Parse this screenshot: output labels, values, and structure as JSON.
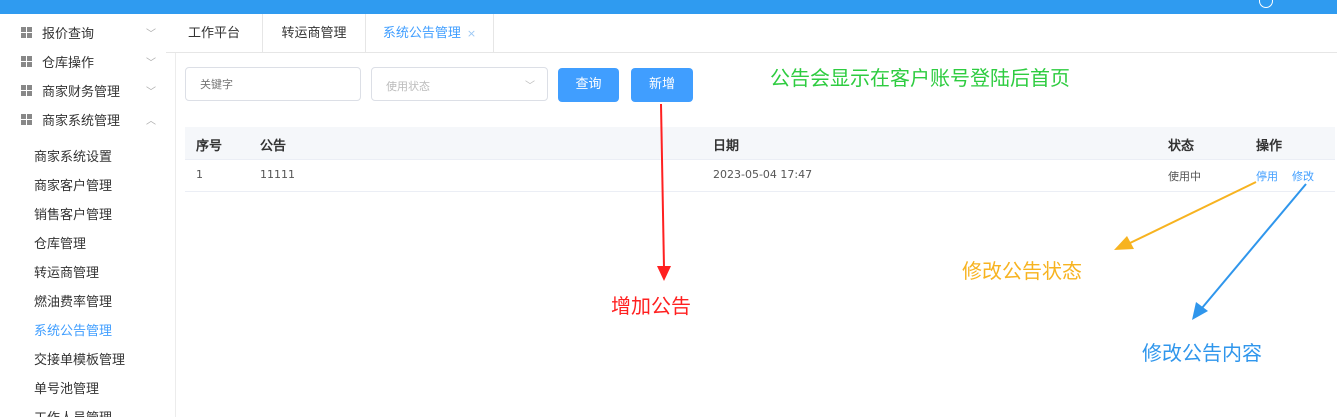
{
  "sidebar": {
    "groups": [
      {
        "label": "报价查询"
      },
      {
        "label": "仓库操作"
      },
      {
        "label": "商家财务管理"
      },
      {
        "label": "商家系统管理"
      }
    ],
    "subitems": [
      {
        "label": "商家系统设置"
      },
      {
        "label": "商家客户管理"
      },
      {
        "label": "销售客户管理"
      },
      {
        "label": "仓库管理"
      },
      {
        "label": "转运商管理"
      },
      {
        "label": "燃油费率管理"
      },
      {
        "label": "系统公告管理"
      },
      {
        "label": "交接单模板管理"
      },
      {
        "label": "单号池管理"
      },
      {
        "label": "工作人员管理"
      }
    ],
    "active_item": "系统公告管理"
  },
  "tabs": [
    {
      "label": "工作平台"
    },
    {
      "label": "转运商管理"
    },
    {
      "label": "系统公告管理",
      "close": "×"
    }
  ],
  "filters": {
    "keyword_placeholder": "关键字",
    "status_placeholder": "使用状态",
    "query_label": "查询",
    "add_label": "新增"
  },
  "table": {
    "headers": {
      "index": "序号",
      "notice": "公告",
      "date": "日期",
      "status": "状态",
      "actions": "操作"
    },
    "rows": [
      {
        "index": "1",
        "notice": "11111",
        "date": "2023-05-04 17:47",
        "status": "使用中",
        "disable": "停用",
        "edit": "修改"
      }
    ]
  },
  "annotations": {
    "note_top": "公告会显示在客户账号登陆后首页",
    "note_add": "增加公告",
    "note_status": "修改公告状态",
    "note_content": "修改公告内容"
  },
  "colors": {
    "primary": "#409eff",
    "topbar": "#2f9bf0",
    "note_green": "#2ecc40",
    "note_red": "#ff2020",
    "note_orange": "#f7b320",
    "note_blue": "#2f96ec"
  }
}
